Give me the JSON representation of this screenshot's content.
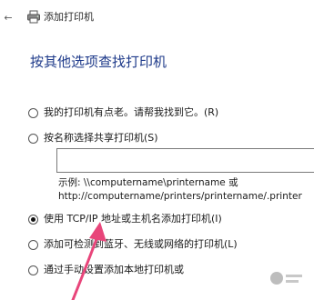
{
  "window": {
    "back_icon": "back-arrow-icon",
    "title_icon": "printer-icon",
    "title": "添加打印机"
  },
  "page": {
    "heading": "按其他选项查找打印机"
  },
  "options": [
    {
      "label": "我的打印机有点老。请帮我找到它。(R)",
      "checked": false
    },
    {
      "label": "按名称选择共享打印机(S)",
      "checked": false
    },
    {
      "label": "使用 TCP/IP 地址或主机名添加打印机(I)",
      "checked": true
    },
    {
      "label": "添加可检测到蓝牙、无线或网络的打印机(L)",
      "checked": false
    },
    {
      "label": "通过手动设置添加本地打印机或",
      "checked": false
    }
  ],
  "share_input": {
    "value": ""
  },
  "example": {
    "line1": "示例: \\\\computername\\printername 或",
    "line2": "http://computername/printers/printername/.printer"
  },
  "annotation": {
    "arrow_color": "#e8457a",
    "arrow_icon": "pink-arrow-annotation"
  }
}
